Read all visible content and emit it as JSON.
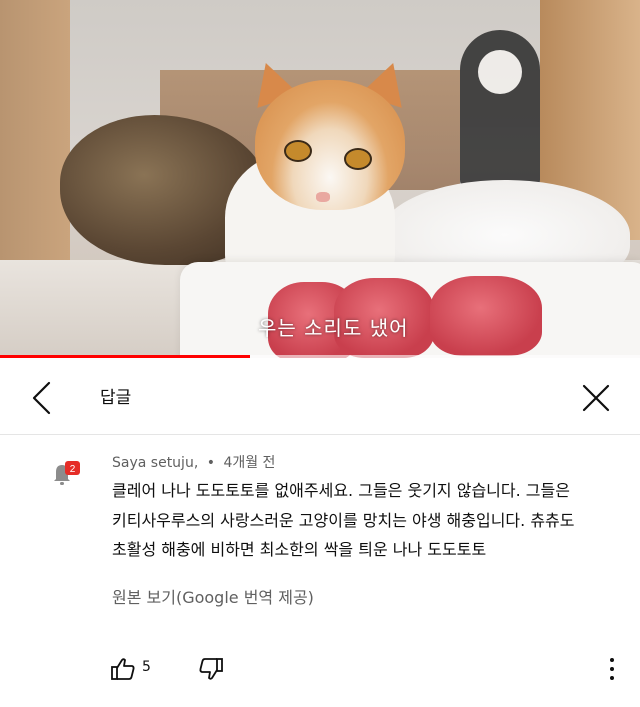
{
  "video": {
    "caption": "우는 소리도 냈어",
    "progress_fraction": 0.39,
    "colors": {
      "progress": "#ff0000"
    }
  },
  "header": {
    "title": "답글",
    "back_icon": "chevron-left-icon",
    "close_icon": "close-icon"
  },
  "comment": {
    "author": "Saya setuju,",
    "separator": "•",
    "time": "4개월 전",
    "avatar_icon": "notification-bell-icon",
    "avatar_badge": "2",
    "text_lines": [
      "클레어 나나 도도토토를 없애주세요. 그들은 웃기지 않습니다. 그들은",
      "키티사우루스의 사랑스러운 고양이를 망치는 야생 해충입니다. 츄츄도",
      "초활성 해충에 비하면 최소한의 싹을 틔운 나나 도도토토"
    ],
    "translate_label": "원본 보기(Google 번역 제공)"
  },
  "actions": {
    "like_count": "5",
    "like_icon": "thumbs-up-icon",
    "dislike_icon": "thumbs-down-icon",
    "more_icon": "more-vertical-icon"
  }
}
